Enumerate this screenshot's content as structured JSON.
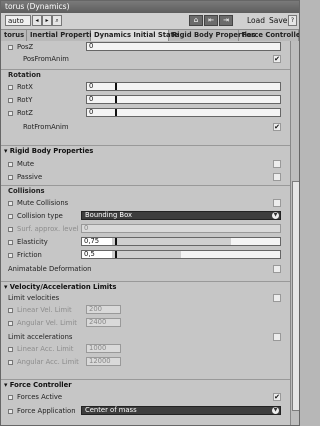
{
  "window": {
    "title": "torus (Dynamics)"
  },
  "toolbar": {
    "auto_label": "auto",
    "load_label": "Load",
    "save_label": "Save",
    "help_label": "?"
  },
  "tabs": [
    "torus",
    "Inertial Properties",
    "Dynamics Initial State",
    "Rigid Body Properties",
    "Force Controller"
  ],
  "position": {
    "posz_label": "PosZ",
    "posz_value": "0",
    "pos_from_anim_label": "PosFromAnim",
    "pos_from_anim_checked": "✔"
  },
  "rotation": {
    "title": "Rotation",
    "rotx_label": "RotX",
    "rotx_value": "0",
    "roty_label": "RotY",
    "roty_value": "0",
    "rotz_label": "RotZ",
    "rotz_value": "0",
    "rot_from_anim_label": "RotFromAnim",
    "rot_from_anim_checked": "✔"
  },
  "rigid": {
    "title": "Rigid Body Properties",
    "mute_label": "Mute",
    "passive_label": "Passive",
    "collisions_title": "Collisions",
    "mute_collisions_label": "Mute Collisions",
    "collision_type_label": "Collision type",
    "collision_type_value": "Bounding Box",
    "surf_label": "Surf. approx. level",
    "surf_value": "0",
    "elasticity_label": "Elasticity",
    "elasticity_value": "0,75",
    "elasticity_fraction": 0.75,
    "friction_label": "Friction",
    "friction_value": "0,5",
    "friction_fraction": 0.5,
    "animatable_label": "Animatable Deformation"
  },
  "velocity": {
    "title": "Velocity/Acceleration Limits",
    "limit_velocities_label": "Limit velocities",
    "linear_vel_label": "Linear Vel. Limit",
    "linear_vel_value": "200",
    "angular_vel_label": "Angular Vel. Limit",
    "angular_vel_value": "2400",
    "limit_acc_label": "Limit accelerations",
    "linear_acc_label": "Linear Acc. Limit",
    "linear_acc_value": "1000",
    "angular_acc_label": "Angular Acc. Limit",
    "angular_acc_value": "12000"
  },
  "force": {
    "title": "Force Controller",
    "forces_active_label": "Forces Active",
    "forces_active_checked": "✔",
    "force_app_label": "Force Application",
    "force_app_value": "Center of mass"
  }
}
